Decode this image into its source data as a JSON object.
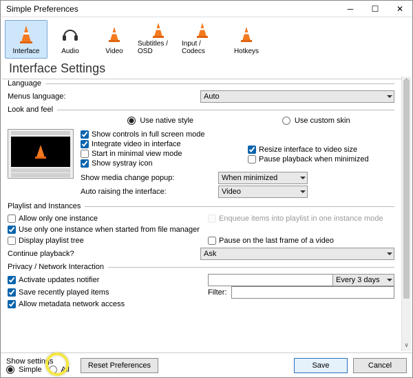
{
  "window": {
    "title": "Simple Preferences"
  },
  "tabs": [
    "Interface",
    "Audio",
    "Video",
    "Subtitles / OSD",
    "Input / Codecs",
    "Hotkeys"
  ],
  "pageTitle": "Interface Settings",
  "language": {
    "groupTitle": "Language",
    "label": "Menus language:",
    "value": "Auto"
  },
  "look": {
    "groupTitle": "Look and feel",
    "native": "Use native style",
    "custom": "Use custom skin",
    "showControls": "Show controls in full screen mode",
    "integrate": "Integrate video in interface",
    "startMinimal": "Start in minimal view mode",
    "systray": "Show systray icon",
    "resize": "Resize interface to video size",
    "pauseMin": "Pause playback when minimized",
    "mediaPopupLabel": "Show media change popup:",
    "mediaPopupValue": "When minimized",
    "autoRaiseLabel": "Auto raising the interface:",
    "autoRaiseValue": "Video"
  },
  "playlist": {
    "groupTitle": "Playlist and Instances",
    "allowOne": "Allow only one instance",
    "enqueue": "Enqueue items into playlist in one instance mode",
    "oneFM": "Use only one instance when started from file manager",
    "displayTree": "Display playlist tree",
    "pauseLast": "Pause on the last frame of a video",
    "continueLabel": "Continue playback?",
    "continueValue": "Ask"
  },
  "privacy": {
    "groupTitle": "Privacy / Network Interaction",
    "updates": "Activate updates notifier",
    "everyValue": "Every 3 days",
    "saveRecent": "Save recently played items",
    "filterLabel": "Filter:",
    "metadata": "Allow metadata network access"
  },
  "footer": {
    "showLabel": "Show settings",
    "simple": "Simple",
    "all": "All",
    "reset": "Reset Preferences",
    "save": "Save",
    "cancel": "Cancel"
  }
}
